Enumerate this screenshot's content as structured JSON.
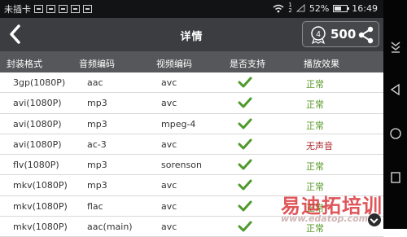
{
  "status_bar": {
    "carrier": "未插卡",
    "sim_slot_1": "1",
    "sim_slot_2": "2",
    "battery_percent": "52%",
    "time": "16:49"
  },
  "header": {
    "title": "详情",
    "medal_number": "4",
    "score": "500"
  },
  "table": {
    "columns": [
      "封装格式",
      "音频编码",
      "视频编码",
      "是否支持",
      "播放效果"
    ],
    "rows": [
      {
        "container": "3gp(1080P)",
        "audio": "aac",
        "video": "avc",
        "result": "正常",
        "status": "ok"
      },
      {
        "container": "avi(1080P)",
        "audio": "mp3",
        "video": "avc",
        "result": "正常",
        "status": "ok"
      },
      {
        "container": "avi(1080P)",
        "audio": "mp3",
        "video": "mpeg-4",
        "result": "正常",
        "status": "ok"
      },
      {
        "container": "avi(1080P)",
        "audio": "ac-3",
        "video": "avc",
        "result": "无声音",
        "status": "bad"
      },
      {
        "container": "flv(1080P)",
        "audio": "mp3",
        "video": "sorenson",
        "result": "正常",
        "status": "ok"
      },
      {
        "container": "mkv(1080P)",
        "audio": "mp3",
        "video": "avc",
        "result": "正常",
        "status": "ok"
      },
      {
        "container": "mkv(1080P)",
        "audio": "flac",
        "video": "avc",
        "result": "正常",
        "status": "ok"
      },
      {
        "container": "mkv(1080P)",
        "audio": "aac(main)",
        "video": "avc",
        "result": "正常",
        "status": "ok"
      }
    ]
  },
  "watermark": {
    "text": "易迪拓培训",
    "url": "www.edatop.com"
  },
  "colors": {
    "appbar": "#3c3d40",
    "table_header": "#56575a",
    "ok_green": "#5a9a2a",
    "bad_red": "#b0282c"
  }
}
